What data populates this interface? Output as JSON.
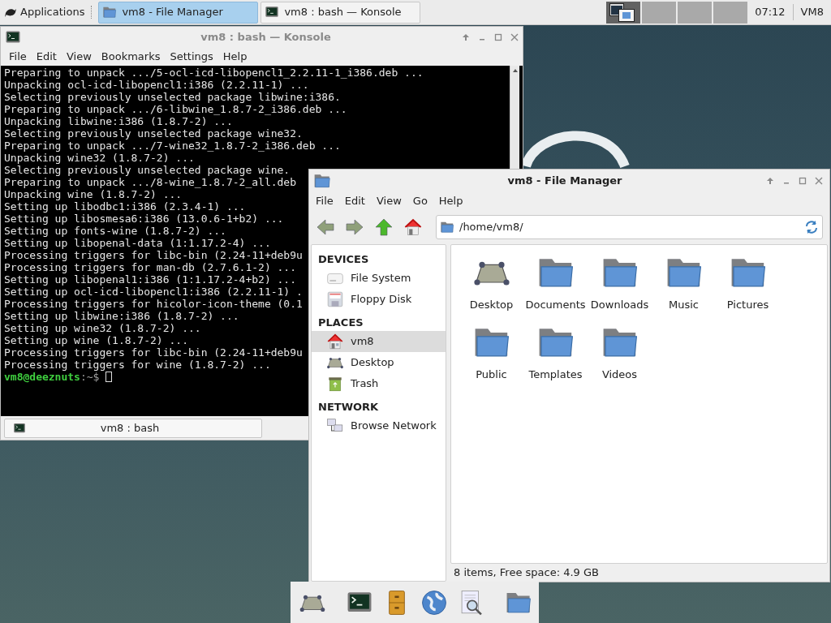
{
  "panel": {
    "menu": "Applications",
    "tasks": [
      {
        "title": "vm8 - File Manager",
        "kind": "folder",
        "selected": true
      },
      {
        "title": "vm8 : bash — Konsole",
        "kind": "terminal",
        "selected": false
      }
    ],
    "workspaces": [
      {
        "selected": true
      },
      {
        "selected": false
      },
      {
        "selected": false
      },
      {
        "selected": false
      }
    ],
    "clock": "07:12",
    "user": "VM8"
  },
  "konsole": {
    "title": "vm8 : bash — Konsole",
    "menu": [
      "File",
      "Edit",
      "View",
      "Bookmarks",
      "Settings",
      "Help"
    ],
    "lines": [
      "Preparing to unpack .../5-ocl-icd-libopencl1_2.2.11-1_i386.deb ...",
      "Unpacking ocl-icd-libopencl1:i386 (2.2.11-1) ...",
      "Selecting previously unselected package libwine:i386.",
      "Preparing to unpack .../6-libwine_1.8.7-2_i386.deb ...",
      "Unpacking libwine:i386 (1.8.7-2) ...",
      "Selecting previously unselected package wine32.",
      "Preparing to unpack .../7-wine32_1.8.7-2_i386.deb ...",
      "Unpacking wine32 (1.8.7-2) ...",
      "Selecting previously unselected package wine.",
      "Preparing to unpack .../8-wine_1.8.7-2_all.deb",
      "Unpacking wine (1.8.7-2) ...",
      "Setting up libodbc1:i386 (2.3.4-1) ...",
      "Setting up libosmesa6:i386 (13.0.6-1+b2) ...",
      "Setting up fonts-wine (1.8.7-2) ...",
      "Setting up libopenal-data (1:1.17.2-4) ...",
      "Processing triggers for libc-bin (2.24-11+deb9u",
      "Processing triggers for man-db (2.7.6.1-2) ...",
      "Setting up libopenal1:i386 (1:1.17.2-4+b2) ...",
      "Setting up ocl-icd-libopencl1:i386 (2.2.11-1) .",
      "Processing triggers for hicolor-icon-theme (0.1",
      "Setting up libwine:i386 (1.8.7-2) ...",
      "Setting up wine32 (1.8.7-2) ...",
      "Setting up wine (1.8.7-2) ...",
      "Processing triggers for libc-bin (2.24-11+deb9u",
      "Processing triggers for wine (1.8.7-2) ..."
    ],
    "prompt": {
      "user": "vm8@deeznuts",
      "path": ":~$"
    },
    "tab": "vm8 : bash"
  },
  "file_manager": {
    "title": "vm8 - File Manager",
    "menu": [
      "File",
      "Edit",
      "View",
      "Go",
      "Help"
    ],
    "path": "/home/vm8/",
    "sidebar": [
      {
        "heading": "DEVICES",
        "items": [
          {
            "label": "File System",
            "kind": "drive",
            "selected": false
          },
          {
            "label": "Floppy Disk",
            "kind": "floppy",
            "selected": false
          }
        ]
      },
      {
        "heading": "PLACES",
        "items": [
          {
            "label": "vm8",
            "kind": "home",
            "selected": true
          },
          {
            "label": "Desktop",
            "kind": "desktop",
            "selected": false
          },
          {
            "label": "Trash",
            "kind": "trash",
            "selected": false
          }
        ]
      },
      {
        "heading": "NETWORK",
        "items": [
          {
            "label": "Browse Network",
            "kind": "network",
            "selected": false
          }
        ]
      }
    ],
    "files": [
      {
        "name": "Desktop",
        "kind": "desktop"
      },
      {
        "name": "Documents",
        "kind": "folder"
      },
      {
        "name": "Downloads",
        "kind": "folder"
      },
      {
        "name": "Music",
        "kind": "folder"
      },
      {
        "name": "Pictures",
        "kind": "folder"
      },
      {
        "name": "Public",
        "kind": "folder"
      },
      {
        "name": "Templates",
        "kind": "folder"
      },
      {
        "name": "Videos",
        "kind": "folder"
      }
    ],
    "status": "8 items, Free space: 4.9 GB"
  },
  "dock": [
    {
      "kind": "desktop"
    },
    {
      "kind": "terminal"
    },
    {
      "kind": "cabinet"
    },
    {
      "kind": "globe"
    },
    {
      "kind": "search"
    },
    {
      "kind": "folder"
    }
  ]
}
